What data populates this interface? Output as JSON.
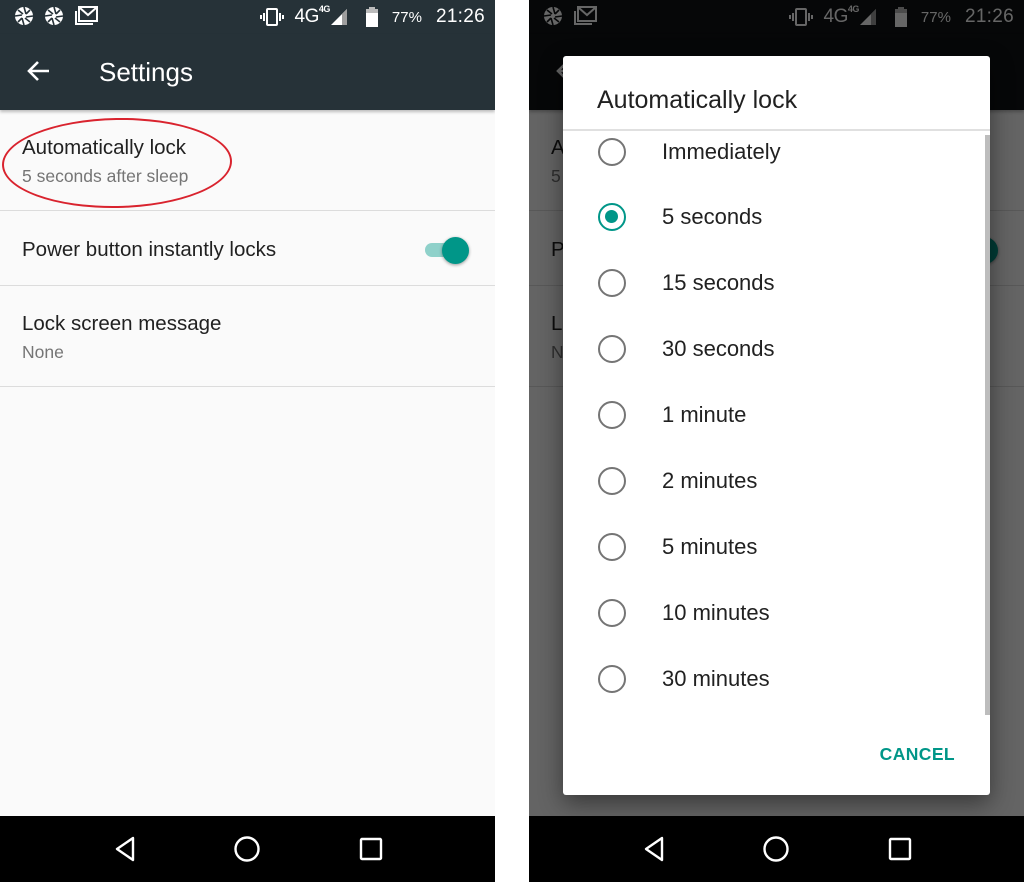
{
  "status_bar": {
    "left_icons": [
      "camera-shutter-icon",
      "camera-shutter-icon",
      "gmail-icon"
    ],
    "right_panel_left_icons": [
      "camera-shutter-icon",
      "gmail-icon"
    ],
    "vibrate_icon": "vibrate-icon",
    "network": "4G",
    "network_badge": "4G",
    "signal_icon": "signal-icon",
    "battery_icon": "battery-icon",
    "battery_percent": "77%",
    "time": "21:26"
  },
  "toolbar": {
    "back_icon": "arrow-back-icon",
    "title": "Settings"
  },
  "settings": {
    "items": [
      {
        "title": "Automatically lock",
        "subtitle": "5 seconds after sleep",
        "highlighted": true
      },
      {
        "title": "Power button instantly locks",
        "toggle": true,
        "toggle_color": "#009688"
      },
      {
        "title": "Lock screen message",
        "subtitle": "None"
      }
    ]
  },
  "peek": {
    "item0_title": "A",
    "item0_sub": "5",
    "item1_title": "P",
    "item2_title": "L",
    "item2_sub": "N"
  },
  "dialog": {
    "title": "Automatically lock",
    "selected": "5 seconds",
    "options": [
      {
        "label": "Immediately",
        "checked": false
      },
      {
        "label": "5 seconds",
        "checked": true
      },
      {
        "label": "15 seconds",
        "checked": false
      },
      {
        "label": "30 seconds",
        "checked": false
      },
      {
        "label": "1 minute",
        "checked": false
      },
      {
        "label": "2 minutes",
        "checked": false
      },
      {
        "label": "5 minutes",
        "checked": false
      },
      {
        "label": "10 minutes",
        "checked": false
      },
      {
        "label": "30 minutes",
        "checked": false
      }
    ],
    "cancel_label": "CANCEL",
    "accent_color": "#009688"
  },
  "nav_bar": {
    "back": "nav-back-icon",
    "home": "nav-home-icon",
    "recents": "nav-recents-icon"
  }
}
